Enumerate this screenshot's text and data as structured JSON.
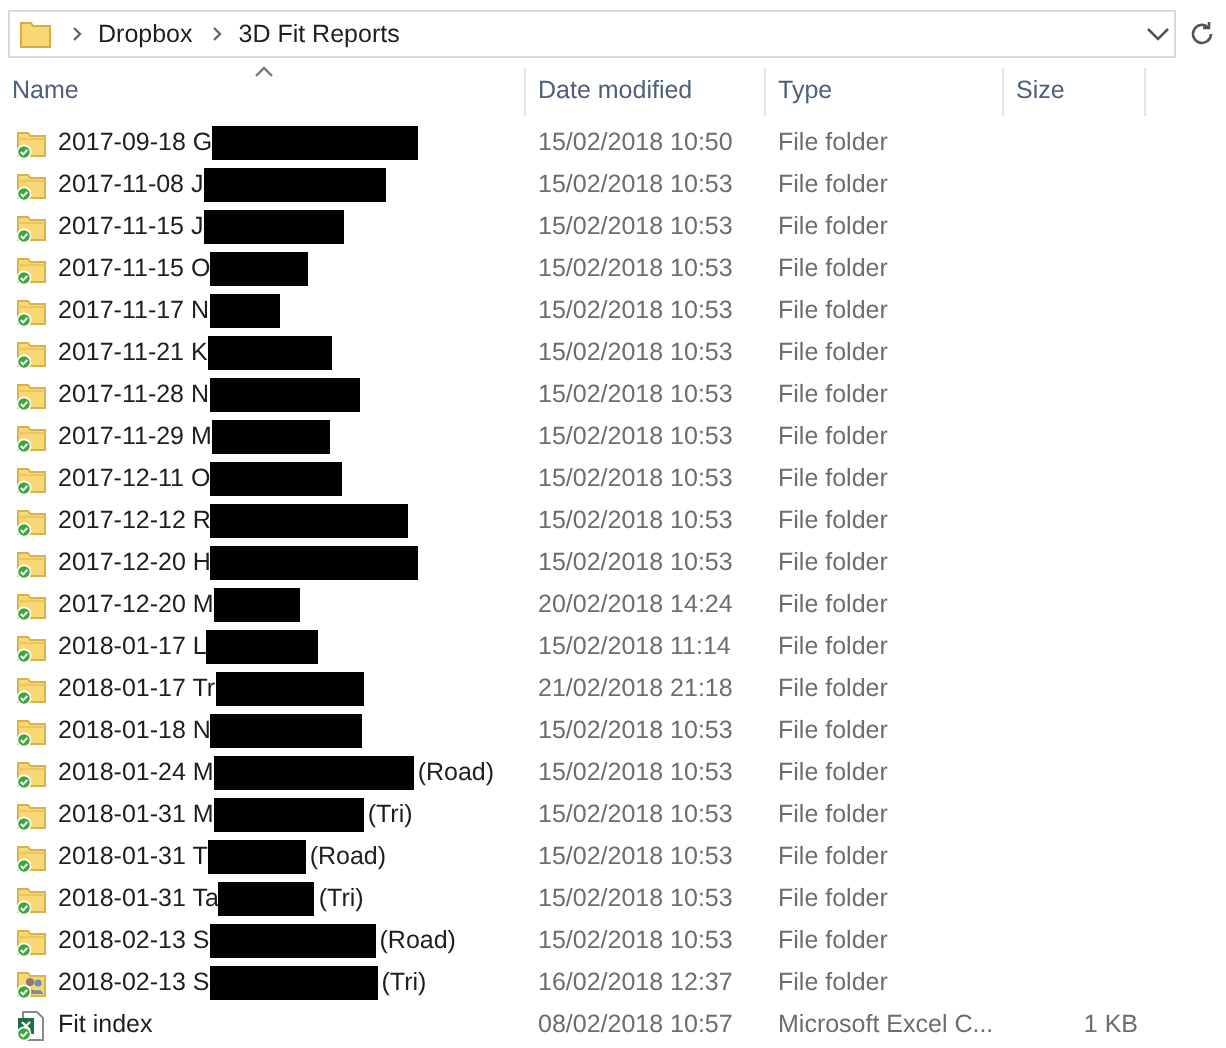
{
  "address_bar": {
    "path": [
      "Dropbox",
      "3D Fit Reports"
    ]
  },
  "columns": [
    {
      "label": "Name",
      "sorted": true
    },
    {
      "label": "Date modified",
      "sorted": false
    },
    {
      "label": "Type",
      "sorted": false
    },
    {
      "label": "Size",
      "sorted": false
    }
  ],
  "rows": [
    {
      "kind": "folder",
      "synced": true,
      "name": "2017-09-18 G",
      "redacted": true,
      "date": "15/02/2018 10:50",
      "type": "File folder"
    },
    {
      "kind": "folder",
      "synced": true,
      "name": "2017-11-08 J",
      "redacted": true,
      "date": "15/02/2018 10:53",
      "type": "File folder"
    },
    {
      "kind": "folder",
      "synced": true,
      "name": "2017-11-15 J",
      "redacted": true,
      "date": "15/02/2018 10:53",
      "type": "File folder"
    },
    {
      "kind": "folder",
      "synced": true,
      "name": "2017-11-15 O",
      "redacted": true,
      "date": "15/02/2018 10:53",
      "type": "File folder"
    },
    {
      "kind": "folder",
      "synced": true,
      "name": "2017-11-17 N",
      "redacted": true,
      "date": "15/02/2018 10:53",
      "type": "File folder"
    },
    {
      "kind": "folder",
      "synced": true,
      "name": "2017-11-21 K",
      "redacted": true,
      "date": "15/02/2018 10:53",
      "type": "File folder"
    },
    {
      "kind": "folder",
      "synced": true,
      "name": "2017-11-28 N",
      "redacted": true,
      "date": "15/02/2018 10:53",
      "type": "File folder"
    },
    {
      "kind": "folder",
      "synced": true,
      "name": "2017-11-29 M",
      "redacted": true,
      "date": "15/02/2018 10:53",
      "type": "File folder"
    },
    {
      "kind": "folder",
      "synced": true,
      "name": "2017-12-11 O",
      "redacted": true,
      "date": "15/02/2018 10:53",
      "type": "File folder"
    },
    {
      "kind": "folder",
      "synced": true,
      "name": "2017-12-12 R",
      "redacted": true,
      "date": "15/02/2018 10:53",
      "type": "File folder"
    },
    {
      "kind": "folder",
      "synced": true,
      "name": "2017-12-20 H",
      "redacted": true,
      "date": "15/02/2018 10:53",
      "type": "File folder"
    },
    {
      "kind": "folder",
      "synced": true,
      "name": "2017-12-20 M",
      "redacted": true,
      "date": "20/02/2018 14:24",
      "type": "File folder"
    },
    {
      "kind": "folder",
      "synced": true,
      "name": "2018-01-17 L",
      "redacted": true,
      "date": "15/02/2018 11:14",
      "type": "File folder"
    },
    {
      "kind": "folder",
      "synced": true,
      "name": "2018-01-17 Tr",
      "redacted": true,
      "date": "21/02/2018 21:18",
      "type": "File folder"
    },
    {
      "kind": "folder",
      "synced": true,
      "name": "2018-01-18 N",
      "redacted": true,
      "date": "15/02/2018 10:53",
      "type": "File folder"
    },
    {
      "kind": "folder",
      "synced": true,
      "name": "2018-01-24 M",
      "redacted": true,
      "suffix": "(Road)",
      "date": "15/02/2018 10:53",
      "type": "File folder"
    },
    {
      "kind": "folder",
      "synced": true,
      "name": "2018-01-31 M",
      "redacted": true,
      "suffix": "(Tri)",
      "date": "15/02/2018 10:53",
      "type": "File folder"
    },
    {
      "kind": "folder",
      "synced": true,
      "name": "2018-01-31 T",
      "redacted": true,
      "suffix": "(Road)",
      "date": "15/02/2018 10:53",
      "type": "File folder"
    },
    {
      "kind": "folder",
      "synced": true,
      "name": "2018-01-31 Ta",
      "redacted": true,
      "suffix": "(Tri)",
      "date": "15/02/2018 10:53",
      "type": "File folder"
    },
    {
      "kind": "folder",
      "synced": true,
      "name": "2018-02-13 S",
      "redacted": true,
      "suffix": "(Road)",
      "date": "15/02/2018 10:53",
      "type": "File folder"
    },
    {
      "kind": "shared-folder",
      "synced": true,
      "name": "2018-02-13 S",
      "redacted": true,
      "suffix": "(Tri)",
      "date": "16/02/2018 12:37",
      "type": "File folder"
    },
    {
      "kind": "spreadsheet",
      "synced": true,
      "name": "Fit index",
      "redacted": false,
      "date": "08/02/2018 10:57",
      "type": "Microsoft Excel C...",
      "size": "1 KB"
    }
  ]
}
